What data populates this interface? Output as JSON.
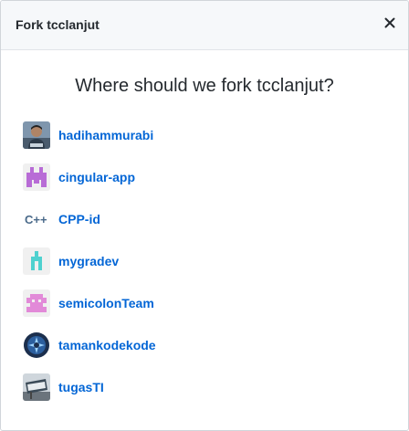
{
  "dialog": {
    "title": "Fork tcclanjut",
    "close_icon": "close-icon",
    "heading": "Where should we fork tcclanjut?"
  },
  "orgs": [
    {
      "name": "hadihammurabi",
      "icon": "user-photo-avatar"
    },
    {
      "name": "cingular-app",
      "icon": "purple-pixel-avatar"
    },
    {
      "name": "CPP-id",
      "icon": "cpp-logo-avatar"
    },
    {
      "name": "mygradev",
      "icon": "teal-pixel-avatar"
    },
    {
      "name": "semicolonTeam",
      "icon": "pink-pixel-avatar"
    },
    {
      "name": "tamankodekode",
      "icon": "blue-badge-avatar"
    },
    {
      "name": "tugasTI",
      "icon": "road-sign-avatar"
    }
  ],
  "colors": {
    "link": "#0366d6",
    "header_bg": "#f6f8fa",
    "text": "#24292e"
  }
}
